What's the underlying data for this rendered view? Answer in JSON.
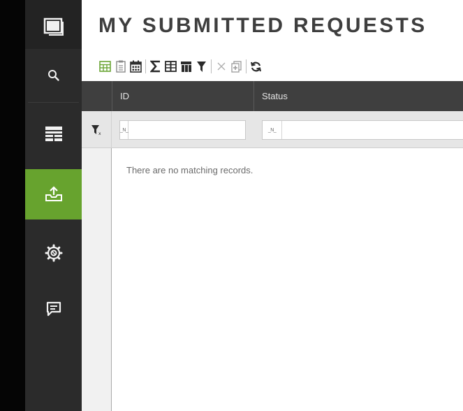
{
  "page": {
    "title": "MY SUBMITTED REQUESTS"
  },
  "sidebar": {
    "active_color": "#67a32e",
    "items": [
      {
        "id": "app",
        "icon": "window-icon"
      },
      {
        "id": "search",
        "icon": "search-icon"
      },
      {
        "id": "reports",
        "icon": "table-list-icon"
      },
      {
        "id": "submitted",
        "icon": "upload-tray-icon",
        "active": true
      },
      {
        "id": "settings",
        "icon": "gear-icon"
      },
      {
        "id": "messages",
        "icon": "chat-icon"
      }
    ]
  },
  "toolbar": {
    "buttons": [
      "grid-icon",
      "clipboard-icon",
      "calendar-icon",
      "sum-icon",
      "columns-icon",
      "table-header-icon",
      "filter-icon",
      "clear-icon",
      "copy-icon",
      "refresh-icon"
    ]
  },
  "grid": {
    "columns": [
      {
        "label": "ID"
      },
      {
        "label": "Status"
      }
    ],
    "filter_null_label": "_N_",
    "empty_message": "There are no matching records."
  }
}
